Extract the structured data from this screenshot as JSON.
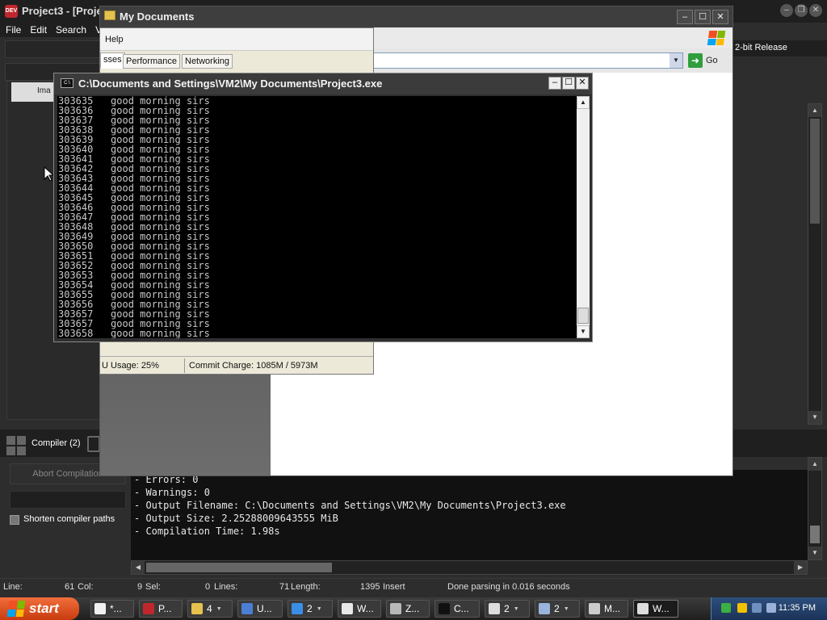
{
  "ide": {
    "title": "Project3 - [Proje",
    "menu": [
      "File",
      "Edit",
      "Search",
      "V"
    ],
    "build_config": "2-bit Release",
    "left_tab": "Ima",
    "bottom_tab": "Compiler (2)",
    "abort_label": "Abort Compilation",
    "shorten_label": "Shorten compiler paths",
    "log": [
      "- Errors: 0",
      "- Warnings: 0",
      "- Output Filename: C:\\Documents and Settings\\VM2\\My Documents\\Project3.exe",
      "- Output Size: 2.25288009643555 MiB",
      "- Compilation Time: 1.98s"
    ],
    "status": {
      "line_label": "Line:",
      "line_value": "61",
      "col_label": "Col:",
      "col_value": "9",
      "sel_label": "Sel:",
      "sel_value": "0",
      "lines_label": "Lines:",
      "lines_value": "71",
      "length_label": "Length:",
      "length_value": "1395",
      "mode": "Insert",
      "message": "Done parsing in 0.016 seconds"
    }
  },
  "explorer": {
    "title": "My Documents",
    "go_label": "Go"
  },
  "taskmgr": {
    "menu_help": "Help",
    "tabs": [
      "sses",
      "Performance",
      "Networking"
    ],
    "cpu_usage": "U Usage: 25%",
    "commit_charge": "Commit Charge: 1085M / 5973M"
  },
  "console": {
    "title": "C:\\Documents and Settings\\VM2\\My Documents\\Project3.exe",
    "lines": [
      "303635   good morning sirs",
      "303636   good morning sirs",
      "303637   good morning sirs",
      "303638   good morning sirs",
      "303639   good morning sirs",
      "303640   good morning sirs",
      "303641   good morning sirs",
      "303642   good morning sirs",
      "303643   good morning sirs",
      "303644   good morning sirs",
      "303645   good morning sirs",
      "303646   good morning sirs",
      "303647   good morning sirs",
      "303648   good morning sirs",
      "303649   good morning sirs",
      "303650   good morning sirs",
      "303651   good morning sirs",
      "303652   good morning sirs",
      "303653   good morning sirs",
      "303654   good morning sirs",
      "303655   good morning sirs",
      "303656   good morning sirs",
      "303657   good morning sirs",
      "303657   good morning sirs",
      "303658   good morning sirs"
    ]
  },
  "taskbar": {
    "start": "start",
    "items": [
      {
        "label": "*...",
        "icon_color": "#f1f1f1"
      },
      {
        "label": "P...",
        "icon_color": "#c0272d"
      },
      {
        "label": "4",
        "icon_color": "#e6c14e",
        "grouped": true
      },
      {
        "label": "U...",
        "icon_color": "#4a7fd4"
      },
      {
        "label": "2",
        "icon_color": "#3a8ee6",
        "grouped": true
      },
      {
        "label": "W...",
        "icon_color": "#e8e8e8"
      },
      {
        "label": "Z...",
        "icon_color": "#b8b8b8"
      },
      {
        "label": "C...",
        "icon_color": "#111111"
      },
      {
        "label": "2",
        "icon_color": "#dddddd",
        "grouped": true
      },
      {
        "label": "2",
        "icon_color": "#9ab4dd",
        "grouped": true
      },
      {
        "label": "M...",
        "icon_color": "#cccccc"
      },
      {
        "label": "W...",
        "icon_color": "#dddddd"
      }
    ],
    "clock": "11:35 PM"
  }
}
